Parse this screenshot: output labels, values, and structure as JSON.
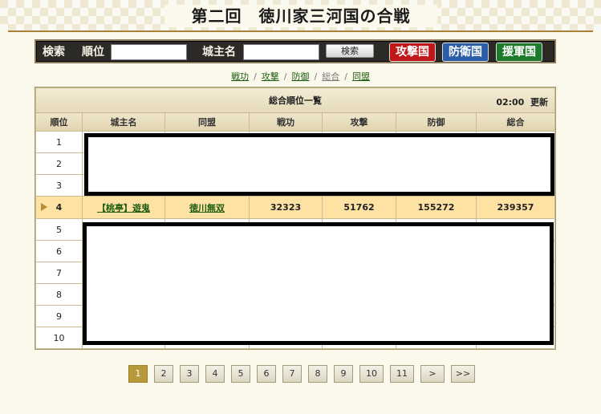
{
  "title": "第二回　徳川家三河国の合戦",
  "search": {
    "label": "検索",
    "rank_label": "順位",
    "rank_value": "",
    "owner_label": "城主名",
    "owner_value": "",
    "search_button": "検索"
  },
  "country_buttons": [
    {
      "label": "攻撃国",
      "color": "#c0171b"
    },
    {
      "label": "防衛国",
      "color": "#2c5ea8"
    },
    {
      "label": "援軍国",
      "color": "#1d7a2a"
    }
  ],
  "subnav": [
    "戦功",
    "攻撃",
    "防御",
    "総合",
    "同盟"
  ],
  "subnav_current": "総合",
  "table": {
    "caption": "総合順位一覧",
    "update_time": "02:00",
    "update_label": "更新",
    "columns": [
      "順位",
      "城主名",
      "同盟",
      "戦功",
      "攻撃",
      "防御",
      "総合"
    ],
    "ranks": [
      "1",
      "2",
      "3",
      "4",
      "5",
      "6",
      "7",
      "8",
      "9",
      "10"
    ],
    "highlight_row": {
      "rank": "4",
      "owner": "【桃亭】遊鬼",
      "alliance": "徳川無双",
      "senko": "32323",
      "attack": "51762",
      "defense": "155272",
      "total": "239357"
    }
  },
  "pagination": {
    "pages": [
      "1",
      "2",
      "3",
      "4",
      "5",
      "6",
      "7",
      "8",
      "9",
      "10",
      "11"
    ],
    "next": ">",
    "last": ">>",
    "current": "1"
  },
  "colors": {
    "highlight": "#fde2a4",
    "link": "#1d5c10",
    "active_page": "#b99a3b"
  }
}
